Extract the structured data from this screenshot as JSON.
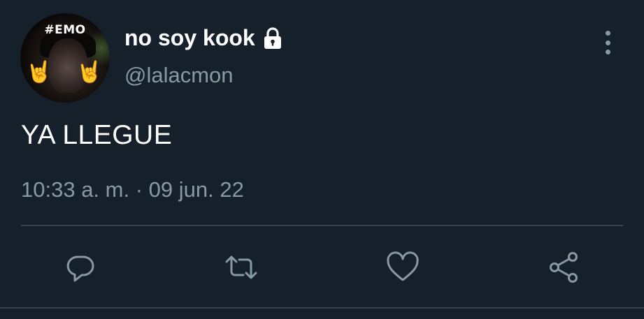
{
  "profile": {
    "avatar_tag": "#EMO",
    "display_name": "no soy kook",
    "handle": "@lalacmon"
  },
  "tweet": {
    "text": "YA LLEGUE",
    "time": "10:33 a. m.",
    "separator": "·",
    "date": "09 jun. 22"
  },
  "icons": {
    "lock": "lock-icon",
    "more": "more-vertical-icon",
    "reply": "reply-icon",
    "retweet": "retweet-icon",
    "like": "heart-icon",
    "share": "share-icon"
  },
  "colors": {
    "background": "#15202b",
    "text": "#ffffff",
    "secondary": "#8899a6",
    "divider": "#38444d"
  }
}
